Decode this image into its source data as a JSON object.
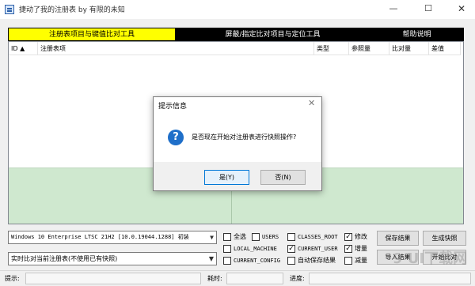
{
  "window": {
    "title": "捷动了我的注册表  by 有限的未知",
    "minimize_glyph": "—",
    "maximize_glyph": "☐",
    "close_glyph": "✕"
  },
  "tabs": [
    {
      "label": "注册表项目与键值比对工具",
      "active": true
    },
    {
      "label": "屏蔽/指定比对项目与定位工具",
      "active": false
    },
    {
      "label": "帮助说明",
      "active": false
    }
  ],
  "list": {
    "columns": [
      "ID ▲",
      "注册表项",
      "类型",
      "参照量",
      "比对量",
      "差值"
    ]
  },
  "controls": {
    "os_select": "Windows 10 Enterprise LTSC 21H2 [10.0.19044.1288] 初装",
    "mode_select": "实时比对当前注册表(不使用已有快照)",
    "dropdown_arrow": "▼",
    "checkboxes": {
      "select_all": {
        "label": "全选",
        "checked": false
      },
      "users": {
        "label": "USERS",
        "checked": false
      },
      "classes_root": {
        "label": "CLASSES_ROOT",
        "checked": false
      },
      "modify": {
        "label": "修改",
        "checked": true
      },
      "local_machine": {
        "label": "LOCAL_MACHINE",
        "checked": false
      },
      "current_user": {
        "label": "CURRENT_USER",
        "checked": true
      },
      "increase": {
        "label": "增量",
        "checked": true
      },
      "current_config": {
        "label": "CURRENT_CONFIG",
        "checked": false
      },
      "auto_save": {
        "label": "自动保存结果",
        "checked": false
      },
      "decrease": {
        "label": "减量",
        "checked": false
      }
    },
    "buttons": {
      "save_result": "保存结果",
      "create_snapshot": "生成快照",
      "import_result": "导入结果",
      "start_compare": "开始比对"
    },
    "check_mark": "✓"
  },
  "status": {
    "hint_label": "提示:",
    "time_label": "耗时:",
    "progress_label": "进度:"
  },
  "dialog": {
    "title": "提示信息",
    "close_glyph": "✕",
    "icon_glyph": "?",
    "message": "是否现在开始对注册表进行快照操作?",
    "yes_label": "是(Y)",
    "no_label": "否(N)"
  },
  "watermark": "9 UI下载网",
  "colors": {
    "active_tab": "#ffff00",
    "inactive_tab": "#000000",
    "diff_pane": "#cfe8cf",
    "question_icon": "#1f6fc9"
  }
}
